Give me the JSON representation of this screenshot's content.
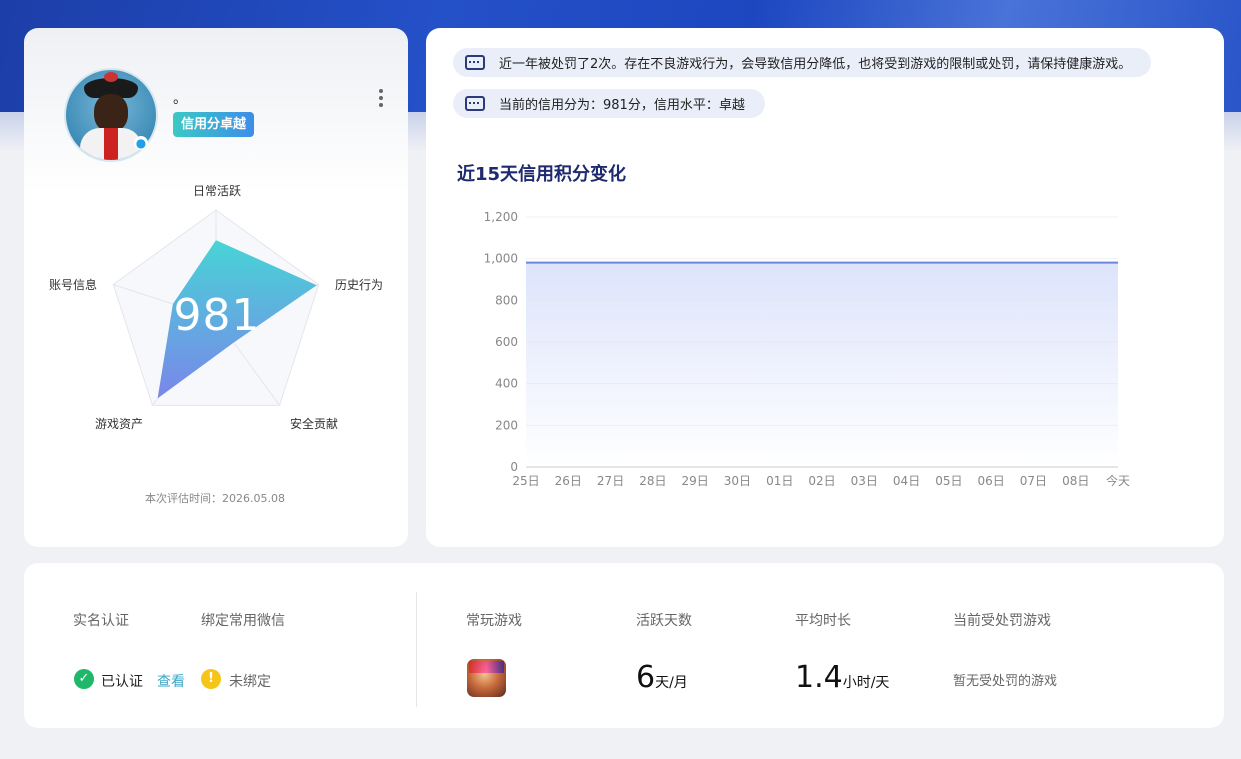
{
  "profile": {
    "nickname": "。",
    "credit_badge": "信用分卓越",
    "score": "981",
    "eval_time": "本次评估时间：2026.05.08",
    "radar": {
      "axes": [
        "日常活跃",
        "历史行为",
        "安全贡献",
        "游戏资产",
        "账号信息"
      ],
      "values": [
        0.72,
        0.98,
        0.28,
        0.92,
        0.42
      ],
      "color_start": "#47d4d6",
      "color_end": "#7a86ea"
    }
  },
  "notices": [
    {
      "icon": "chat-icon",
      "text": "近一年被处罚了2次。存在不良游戏行为，会导致信用分降低，也将受到游戏的限制或处罚，请保持健康游戏。"
    },
    {
      "icon": "chat-icon",
      "text": "当前的信用分为：981分，信用水平：卓越"
    }
  ],
  "chart_title": "近15天信用积分变化",
  "chart_data": {
    "type": "area",
    "title": "近15天信用积分变化",
    "xlabel": "",
    "ylabel": "",
    "categories": [
      "25日",
      "26日",
      "27日",
      "28日",
      "29日",
      "30日",
      "01日",
      "02日",
      "03日",
      "04日",
      "05日",
      "06日",
      "07日",
      "08日",
      "今天"
    ],
    "values": [
      981,
      981,
      981,
      981,
      981,
      981,
      981,
      981,
      981,
      981,
      981,
      981,
      981,
      981,
      981
    ],
    "yticks": [
      "0",
      "200",
      "400",
      "600",
      "800",
      "1,000",
      "1,200"
    ],
    "ylim": [
      0,
      1200
    ],
    "grid": true,
    "line_color": "#6a86de",
    "fill_color": "#dde4fb"
  },
  "stats": {
    "real_name_label": "实名认证",
    "wechat_label": "绑定常用微信",
    "real_name_status": "已认证",
    "view_link": "查看",
    "wechat_status": "未绑定",
    "frequent_game_label": "常玩游戏",
    "active_days_label": "活跃天数",
    "active_days_value": "6",
    "active_days_unit": "天/月",
    "avg_duration_label": "平均时长",
    "avg_duration_value": "1.4",
    "avg_duration_unit": "小时/天",
    "punished_label": "当前受处罚游戏",
    "punished_value": "暂无受处罚的游戏"
  }
}
